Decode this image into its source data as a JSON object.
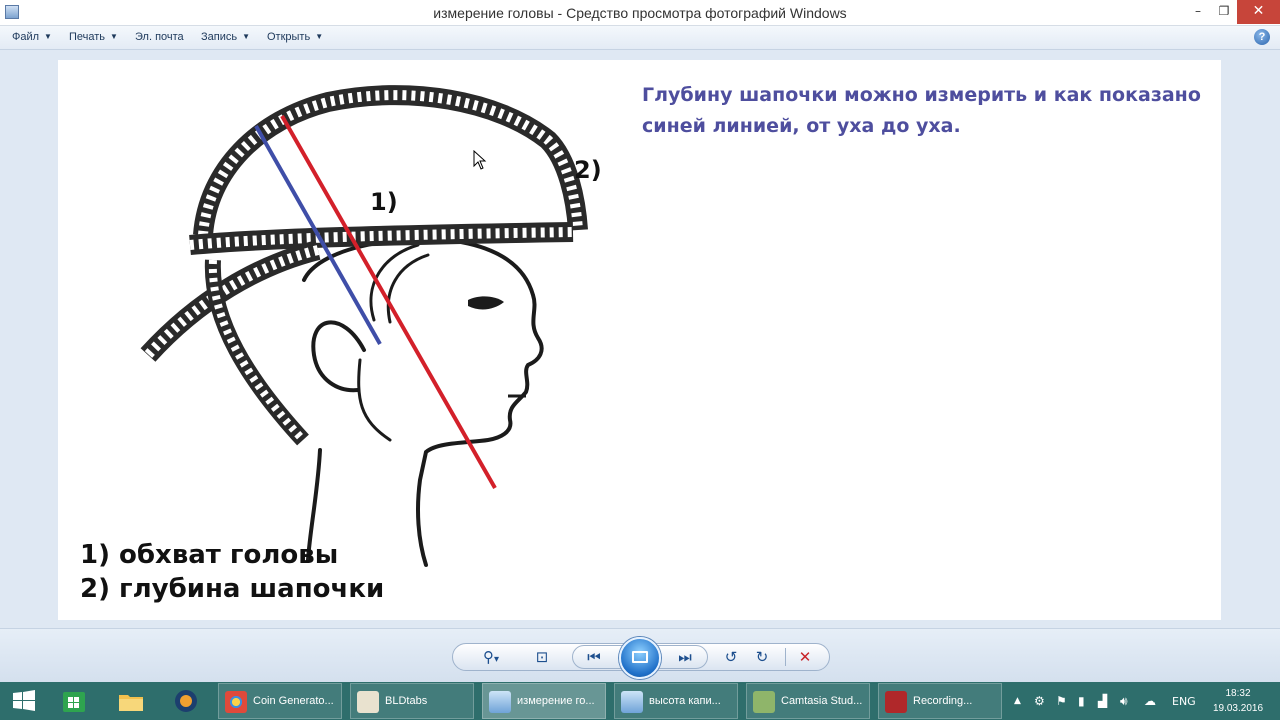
{
  "window": {
    "title": "измерение головы - Средство просмотра фотографий Windows",
    "minimize_glyph": "–",
    "maximize_glyph": "❐",
    "close_glyph": "✕"
  },
  "menu": {
    "items": [
      {
        "label": "Файл",
        "has_arrow": true
      },
      {
        "label": "Печать",
        "has_arrow": true
      },
      {
        "label": "Эл. почта",
        "has_arrow": false
      },
      {
        "label": "Запись",
        "has_arrow": true
      },
      {
        "label": "Открыть",
        "has_arrow": true
      }
    ],
    "arrow_glyph": "▼",
    "help_glyph": "?"
  },
  "photo": {
    "caption": "Глубину шапочки можно измерить и как показано синей линией, от уха до уха.",
    "label_1": "1)",
    "label_2": "2)",
    "legend_1": "1) обхват головы",
    "legend_2": "2) глубина шапочки",
    "caption_color": "#4e4e9e",
    "red_line_color": "#d3202a",
    "blue_line_color": "#3f4ea8"
  },
  "controls": {
    "zoom_glyph": "⚲",
    "zoom_arrow_glyph": "▾",
    "fit_glyph": "⊡",
    "prev_glyph": "⏮",
    "next_glyph": "⏭",
    "rotate_ccw_glyph": "↺",
    "rotate_cw_glyph": "↻",
    "delete_glyph": "✕"
  },
  "taskbar": {
    "color": "#2e6e6c",
    "tasks": [
      {
        "label": "Coin Generato...",
        "icon": "chrome-icon",
        "icon_color": "#e04a3b",
        "active": false
      },
      {
        "label": "BLDtabs",
        "icon": "java-icon",
        "icon_color": "#e9e2cf",
        "active": false
      },
      {
        "label": "измерение го...",
        "icon": "photo-viewer-icon",
        "icon_color": "#6fa3d8",
        "active": true
      },
      {
        "label": "высота капи...",
        "icon": "photo-viewer-icon",
        "icon_color": "#6fa3d8",
        "active": false
      },
      {
        "label": "Camtasia Stud...",
        "icon": "camtasia-icon",
        "icon_color": "#8fb56a",
        "active": false
      },
      {
        "label": "Recording...",
        "icon": "recorder-icon",
        "icon_color": "#b0282a",
        "active": false
      }
    ],
    "tray": {
      "chevron_glyph": "▲",
      "language": "ENG",
      "time": "18:32",
      "date": "19.03.2016"
    }
  }
}
